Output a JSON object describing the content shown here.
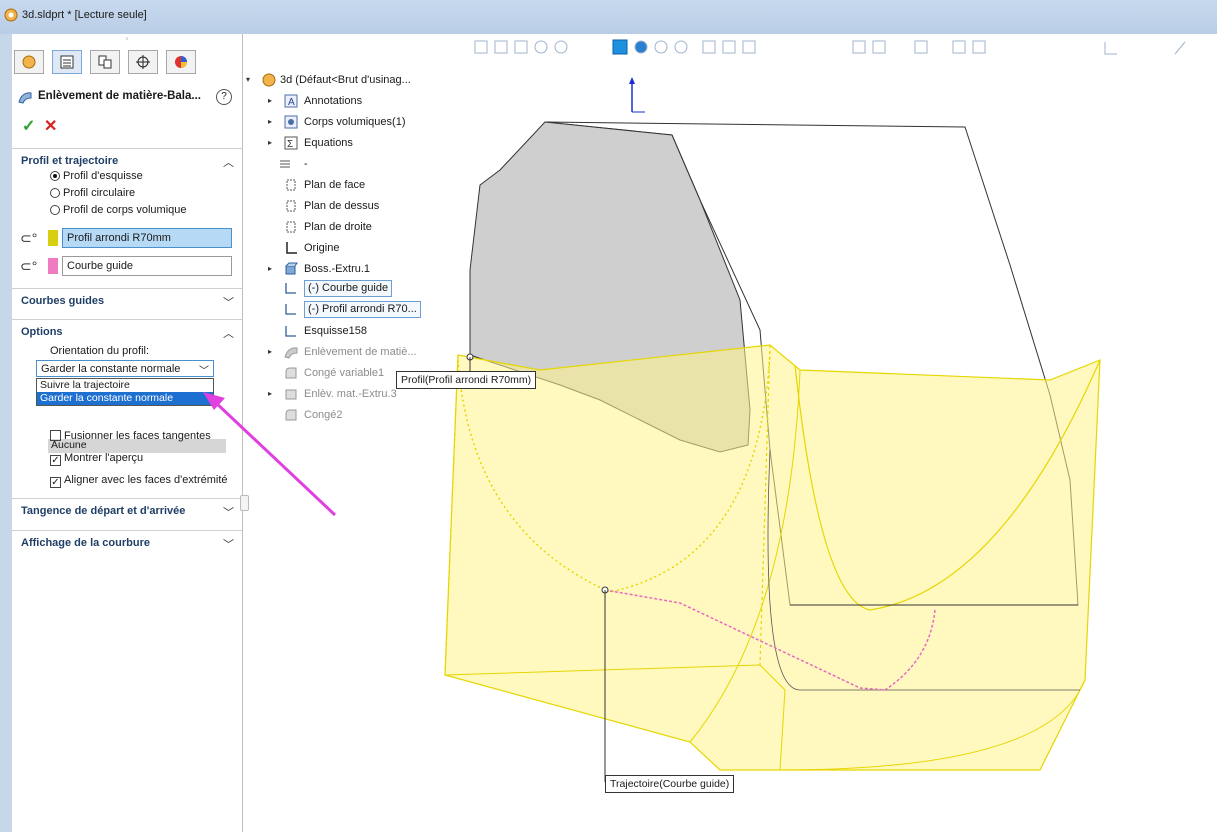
{
  "window": {
    "title": "3d.sldprt * [Lecture seule]"
  },
  "panel": {
    "grip": "◦",
    "feature_title": "Enlèvement de matière-Bala...",
    "help": "?",
    "ok": "✓",
    "cancel": "✕",
    "sections": {
      "profil": "Profil et trajectoire",
      "courbes": "Courbes guides",
      "options": "Options",
      "tangence": "Tangence de départ et d'arrivée",
      "affichage": "Affichage de la courbure"
    },
    "radios": [
      "Profil d'esquisse",
      "Profil circulaire",
      "Profil de corps volumique"
    ],
    "profile_field": "Profil arrondi R70mm",
    "path_field": "Courbe guide",
    "orientation_label": "Orientation du profil:",
    "orientation_value": "Garder la constante normale",
    "orientation_options": [
      "Suivre la trajectoire",
      "Garder la constante normale"
    ],
    "under_value": "Aucune",
    "checkboxes": [
      {
        "label": "Fusionner les faces tangentes",
        "checked": false
      },
      {
        "label": "Montrer l'aperçu",
        "checked": true
      },
      {
        "label": "Aligner avec les faces d'extrémité",
        "checked": true
      }
    ]
  },
  "tree": {
    "root": "3d  (Défaut<Brut d'usinag...",
    "items": [
      "Annotations",
      "Corps volumiques(1)",
      "Equations",
      "-",
      "Plan de face",
      "Plan de dessus",
      "Plan de droite",
      "Origine",
      "Boss.-Extru.1",
      "(-) Courbe guide",
      "(-) Profil arrondi R70...",
      "Esquisse158",
      "Enlèvement de matiè...",
      "Congé variable1",
      "Enlèv. mat.-Extru.3",
      "Congé2"
    ]
  },
  "viewport": {
    "tooltip_profile": "Profil(Profil arrondi R70mm)",
    "tooltip_path": "Trajectoire(Courbe guide)"
  },
  "colors": {
    "accent": "#1e70d0",
    "preview_fill": "#fff7a0",
    "preview_edge": "#e6d600",
    "arrow": "#e040e0",
    "guide": "#e86ac0"
  }
}
